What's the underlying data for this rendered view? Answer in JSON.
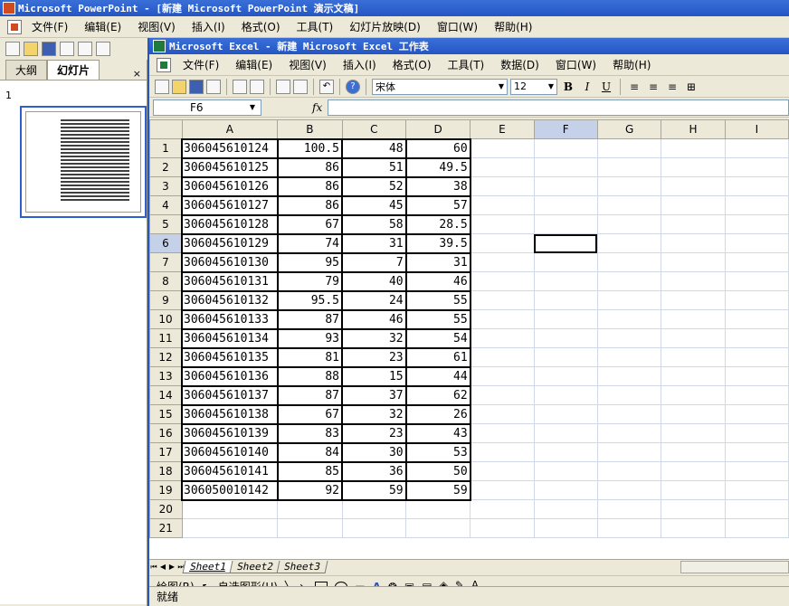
{
  "ppt": {
    "title": "Microsoft PowerPoint - [新建 Microsoft PowerPoint 演示文稿]",
    "menu": [
      "文件(F)",
      "编辑(E)",
      "视图(V)",
      "插入(I)",
      "格式(O)",
      "工具(T)",
      "幻灯片放映(D)",
      "窗口(W)",
      "帮助(H)"
    ],
    "tabs": [
      "大纲",
      "幻灯片"
    ],
    "slide_number": "1"
  },
  "excel": {
    "title": "Microsoft Excel - 新建 Microsoft Excel 工作表",
    "menu": [
      "文件(F)",
      "编辑(E)",
      "视图(V)",
      "插入(I)",
      "格式(O)",
      "工具(T)",
      "数据(D)",
      "窗口(W)",
      "帮助(H)"
    ],
    "font_name": "宋体",
    "font_size": "12",
    "name_box": "F6",
    "fx": "fx",
    "columns": [
      "A",
      "B",
      "C",
      "D",
      "E",
      "F",
      "G",
      "H",
      "I"
    ],
    "rows": [
      [
        "306045610124",
        "100.5",
        "48",
        "60"
      ],
      [
        "306045610125",
        "86",
        "51",
        "49.5"
      ],
      [
        "306045610126",
        "86",
        "52",
        "38"
      ],
      [
        "306045610127",
        "86",
        "45",
        "57"
      ],
      [
        "306045610128",
        "67",
        "58",
        "28.5"
      ],
      [
        "306045610129",
        "74",
        "31",
        "39.5"
      ],
      [
        "306045610130",
        "95",
        "7",
        "31"
      ],
      [
        "306045610131",
        "79",
        "40",
        "46"
      ],
      [
        "306045610132",
        "95.5",
        "24",
        "55"
      ],
      [
        "306045610133",
        "87",
        "46",
        "55"
      ],
      [
        "306045610134",
        "93",
        "32",
        "54"
      ],
      [
        "306045610135",
        "81",
        "23",
        "61"
      ],
      [
        "306045610136",
        "88",
        "15",
        "44"
      ],
      [
        "306045610137",
        "87",
        "37",
        "62"
      ],
      [
        "306045610138",
        "67",
        "32",
        "26"
      ],
      [
        "306045610139",
        "83",
        "23",
        "43"
      ],
      [
        "306045610140",
        "84",
        "30",
        "53"
      ],
      [
        "306045610141",
        "85",
        "36",
        "50"
      ],
      [
        "306050010142",
        "92",
        "59",
        "59"
      ]
    ],
    "empty_row_numbers": [
      "20",
      "21"
    ],
    "sheets": [
      "Sheet1",
      "Sheet2",
      "Sheet3"
    ],
    "draw_menu": "绘图(R)",
    "autoshapes": "自选图形(U)",
    "symbols": "，。、；：？！…‘“（《｛〖【#～·※◇◎□＋－×÷№$¥§",
    "status": "就绪"
  }
}
